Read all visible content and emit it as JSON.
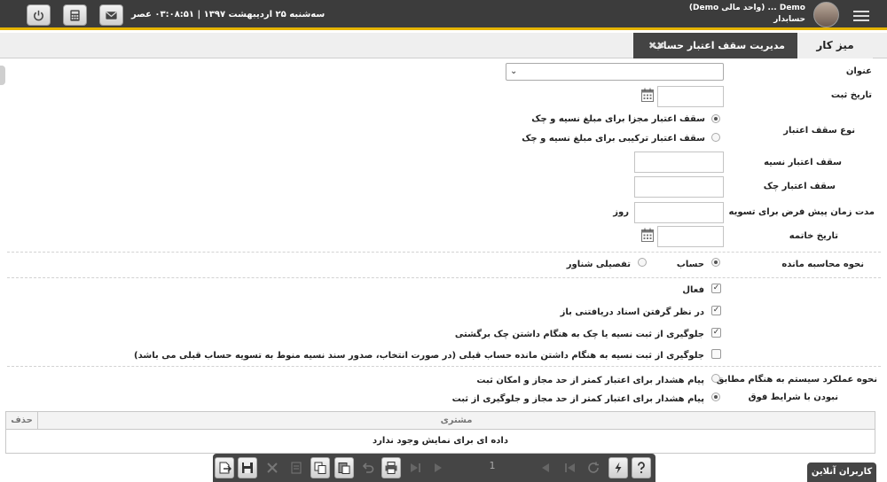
{
  "header": {
    "user_name": "Demo ... (واحد مالی Demo)",
    "user_role": "حسابدار",
    "datetime": "سه‌شنبه ۲۵ اردیبهشت ۱۳۹۷  |  ۰۳:۰۸:۵۱ عصر",
    "accent_color": "#e5b400",
    "icons": [
      "menu-icon",
      "power-icon",
      "calculator-icon",
      "mail-icon"
    ]
  },
  "tabs": {
    "home": "میز کار",
    "active": "مدیریت سقف اعتبار حساب",
    "close_glyph": "✖✖"
  },
  "form": {
    "title_label": "عنوان",
    "title_value": "",
    "reg_date_label": "تاریخ ثبت",
    "limit_type_label": "نوع سقف اعتبار",
    "limit_type_options": [
      "سقف اعتبار مجزا برای مبلغ نسیه و چک",
      "سقف اعتبار ترکیبی برای مبلغ نسیه و چک"
    ],
    "limit_type_selected": 0,
    "credit_limit_label": "سقف اعتبار نسیه",
    "cheque_limit_label": "سقف اعتبار چک",
    "settlement_label": "مدت زمان پیش فرض برای تسویه",
    "settlement_unit": "روز",
    "end_date_label": "تاریخ خاتمه",
    "calc_label": "نحوه محاسبه مانده",
    "calc_options": [
      "حساب",
      "تفصیلی شناور"
    ],
    "calc_selected": 0,
    "active_label": "فعال",
    "open_docs_label": "در نظر گرفتن اسناد دریافتنی باز",
    "bounced_label": "جلوگیری از ثبت نسیه یا چک به هنگام داشتن چک برگشتی",
    "prev_balance_label": "جلوگیری از ثبت نسیه به هنگام داشتن مانده حساب قبلی (در صورت انتخاب، صدور سند نسیه منوط به تسویه حساب قبلی می باشد)",
    "checks": [
      true,
      true,
      true,
      false
    ],
    "behavior_label_1": "نحوه عملکرد سیستم به هنگام مطابق",
    "behavior_label_2": "نبودن با شرایط فوق",
    "behavior_options": [
      "پیام هشدار برای اعتبار کمتر از حد مجاز و امکان ثبت",
      "پیام هشدار برای اعتبار کمتر از حد مجاز و جلوگیری از ثبت"
    ],
    "behavior_selected": 1
  },
  "grid": {
    "col_customer": "مشتری",
    "col_delete": "حذف",
    "empty_text": "داده ای برای نمایش وجود ندارد"
  },
  "toolbar": {
    "page_number": "1",
    "icons": [
      "help-icon",
      "flash-icon",
      "refresh-icon",
      "last-icon",
      "next-icon",
      "prev-icon",
      "first-icon",
      "print-icon",
      "undo-icon",
      "paste-icon",
      "copy-icon",
      "edit-icon",
      "delete-icon",
      "save-icon",
      "new-icon"
    ]
  },
  "online_users": "کاربران آنلاین"
}
